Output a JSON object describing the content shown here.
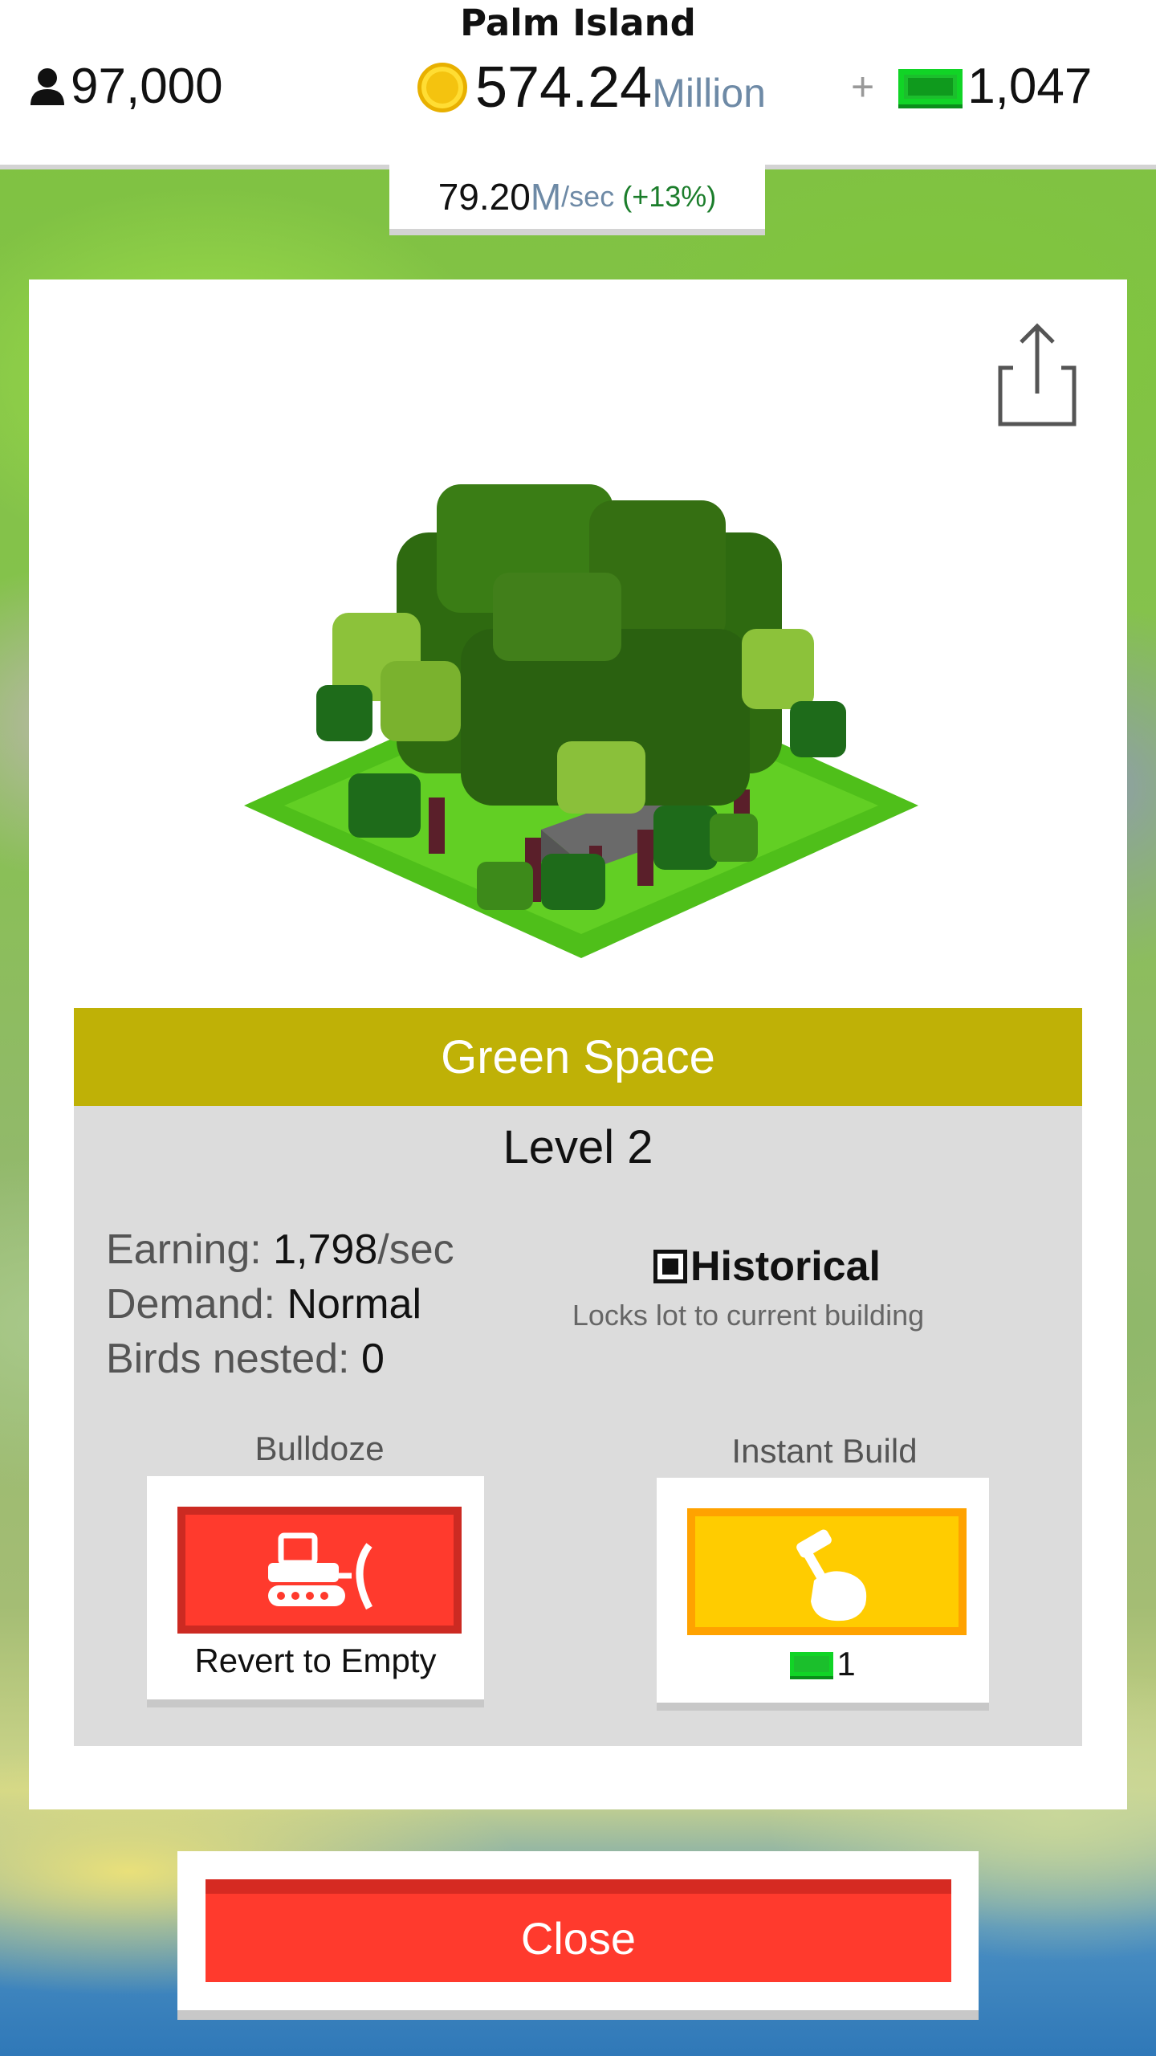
{
  "header": {
    "island_name": "Palm Island",
    "population": "97,000",
    "money_value": "574.24",
    "money_unit": "Million",
    "plus_symbol": "+",
    "cash_count": "1,047",
    "rate_value": "79.20",
    "rate_unit": "M",
    "rate_per": "/sec",
    "rate_bonus": "(+13%)"
  },
  "building": {
    "name": "Green Space",
    "level": "Level 2",
    "earning_label": "Earning:",
    "earning_value": "1,798",
    "earning_unit": "/sec",
    "demand_label": "Demand:",
    "demand_value": "Normal",
    "birds_label": "Birds nested:",
    "birds_value": "0",
    "historical_label": "Historical",
    "historical_checked": true,
    "historical_desc": "Locks lot to current building"
  },
  "actions": {
    "bulldoze_label": "Bulldoze",
    "bulldoze_caption": "Revert to Empty",
    "instant_label": "Instant Build",
    "instant_cost": "1"
  },
  "footer": {
    "close_label": "Close"
  },
  "colors": {
    "title_bar": "#bfb106",
    "bulldoze_red": "#ff3a2d",
    "instant_yellow": "#ffcc00",
    "cash_green": "#1bbf2c"
  },
  "icons": [
    "person-icon",
    "coin-icon",
    "cash-bill-icon",
    "share-icon",
    "bulldozer-icon",
    "hammer-hand-icon",
    "checkbox-icon"
  ]
}
